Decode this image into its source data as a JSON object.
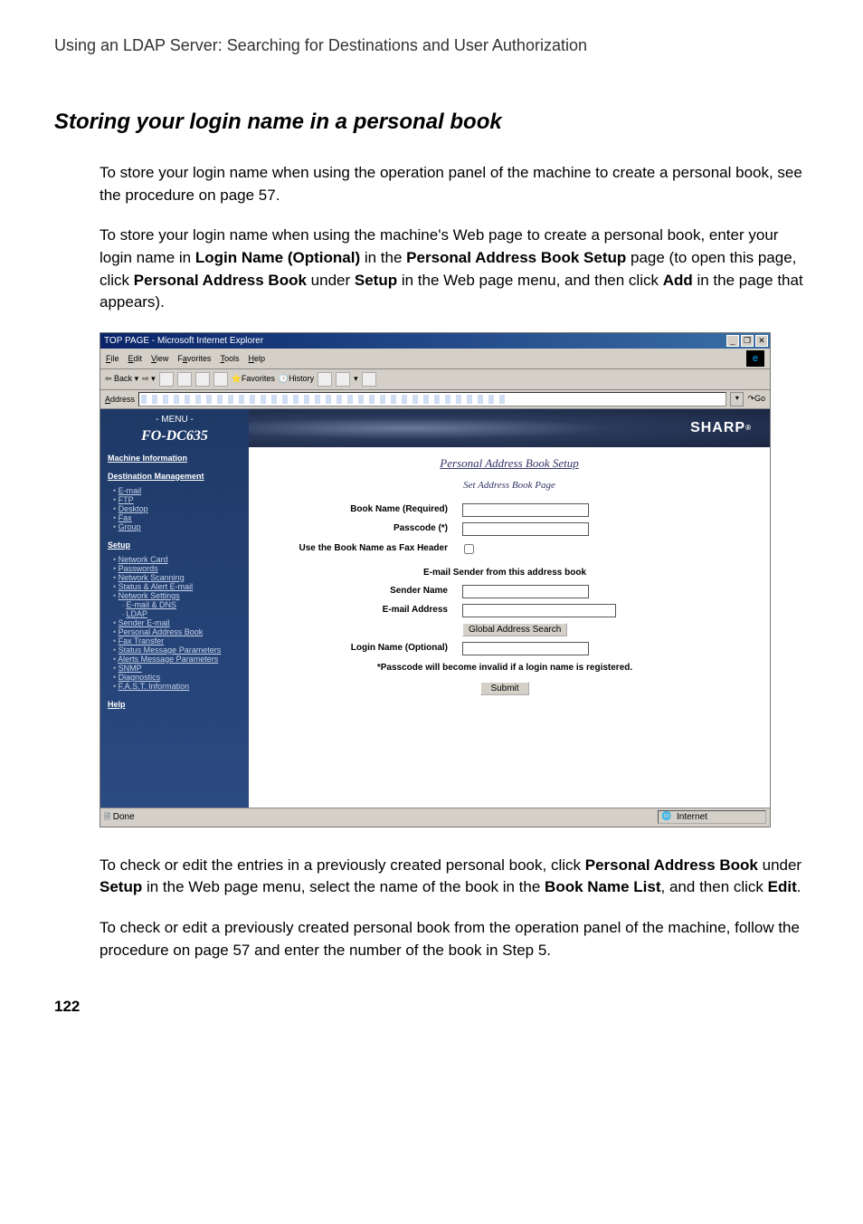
{
  "breadcrumb": "Using an LDAP Server: Searching for Destinations and User Authorization",
  "section_title": "Storing your login name in a personal book",
  "para1": "To store your login name when using the operation panel of the machine to create a personal book, see the procedure on page 57.",
  "para2_pre": "To store your login name when using the machine's Web page to create a personal book, enter your login name in ",
  "para2_b1": "Login Name (Optional)",
  "para2_mid1": " in the ",
  "para2_b2": "Personal Address Book Setup",
  "para2_mid2": " page (to open this page, click ",
  "para2_b3": "Personal Address Book",
  "para2_mid3": " under ",
  "para2_b4": "Setup",
  "para2_mid4": " in the Web page menu, and then click ",
  "para2_b5": "Add",
  "para2_end": " in the page that appears).",
  "para3_pre": "To check or edit the entries in a previously created personal book, click ",
  "para3_b1": "Personal Address Book",
  "para3_mid1": " under ",
  "para3_b2": "Setup",
  "para3_mid2": " in the Web page menu, select the name of the book in the ",
  "para3_b3": "Book Name List",
  "para3_mid3": ", and then click ",
  "para3_b4": "Edit",
  "para3_end": ".",
  "para4": "To check or edit a previously created personal book from the operation panel of the machine, follow the procedure on page 57 and enter the number of the book in Step 5.",
  "page_number": "122",
  "ie": {
    "title": "TOP PAGE - Microsoft Internet Explorer",
    "menus": {
      "file": "File",
      "edit": "Edit",
      "view": "View",
      "favorites": "Favorites",
      "tools": "Tools",
      "help": "Help"
    },
    "toolbar": {
      "back": "Back",
      "favorites": "Favorites",
      "history": "History"
    },
    "addr_label": "Address",
    "go_label": "Go",
    "status_done": "Done",
    "status_zone": "Internet"
  },
  "sidebar": {
    "menu_head": "- MENU -",
    "model": "FO-DC635",
    "machine_info": "Machine Information",
    "dest_mgmt": "Destination Management",
    "dest_items": [
      "E-mail",
      "FTP",
      "Desktop",
      "Fax",
      "Group"
    ],
    "setup": "Setup",
    "setup_items": [
      {
        "t": "Network Card"
      },
      {
        "t": "Passwords"
      },
      {
        "t": "Network Scanning"
      },
      {
        "t": "Status & Alert E-mail"
      },
      {
        "t": "Network Settings"
      },
      {
        "t": "E-mail & DNS",
        "sub": true
      },
      {
        "t": "LDAP",
        "sub": true
      },
      {
        "t": "Sender E-mail"
      },
      {
        "t": "Personal Address Book"
      },
      {
        "t": "Fax Transfer"
      },
      {
        "t": "Status Message Parameters"
      },
      {
        "t": "Alerts Message Parameters"
      },
      {
        "t": "SNMP"
      },
      {
        "t": "Diagnostics"
      },
      {
        "t": "F.A.S.T. Information"
      }
    ],
    "help": "Help"
  },
  "page": {
    "brand": "SHARP",
    "title": "Personal Address Book Setup",
    "subtitle": "Set Address Book Page",
    "form": {
      "book_name": "Book Name (Required)",
      "passcode": "Passcode (*)",
      "use_book_name": "Use the Book Name as Fax Header",
      "section2": "E-mail Sender from this address book",
      "sender_name": "Sender Name",
      "email_addr": "E-mail Address",
      "gas_btn": "Global Address Search",
      "login_name": "Login Name (Optional)",
      "note": "*Passcode will become invalid if a login name is registered.",
      "submit": "Submit"
    }
  }
}
